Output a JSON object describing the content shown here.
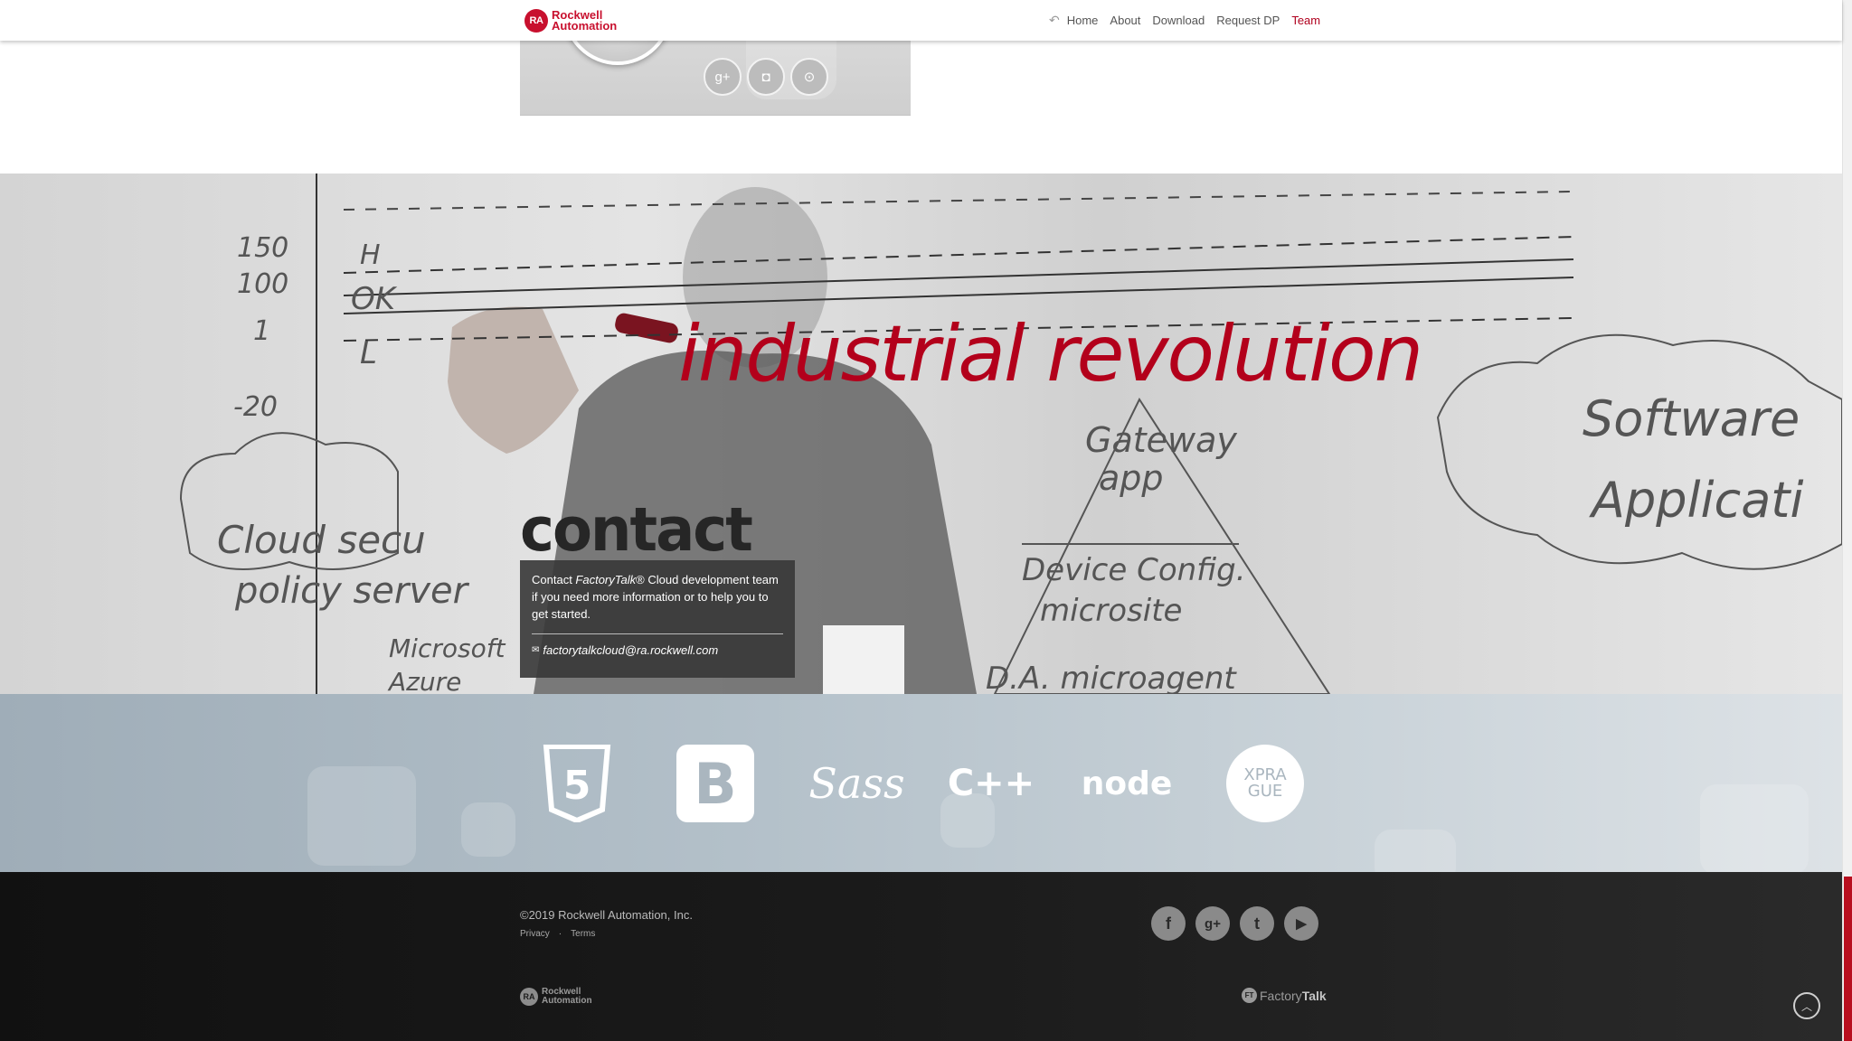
{
  "brand": {
    "badge": "RA",
    "line1": "Rockwell",
    "line2": "Automation"
  },
  "nav": {
    "back_icon": "reply-arrow-icon",
    "items": [
      {
        "label": "Home"
      },
      {
        "label": "About"
      },
      {
        "label": "Download"
      },
      {
        "label": "Request DP"
      },
      {
        "label": "Team",
        "active": true
      }
    ]
  },
  "team_card": {
    "social": [
      {
        "icon": "google-plus-icon",
        "glyph": "g+"
      },
      {
        "icon": "camera-icon",
        "glyph": "◘"
      },
      {
        "icon": "github-icon",
        "glyph": "⊙"
      }
    ]
  },
  "hero": {
    "headline": "industrial revolution",
    "whiteboard": {
      "axis_labels": [
        "150",
        "100",
        "1",
        "-20"
      ],
      "notes": [
        "H",
        "OK",
        "L",
        "Cloud secu",
        "policy server",
        "Microsoft",
        "Azure",
        "Gateway",
        "app",
        "Device Config.",
        "microsite",
        "D.A. microagent",
        "Software",
        "Applicati"
      ]
    }
  },
  "contact": {
    "heading": "contact",
    "text_before": "Contact ",
    "product": "FactoryTalk",
    "text_after": "® Cloud development team if you need more information or to help you to get started.",
    "email_icon": "envelope-icon",
    "email": "factorytalkcloud@ra.rockwell.com"
  },
  "tech_logos": [
    {
      "name": "html5-logo",
      "label": "5"
    },
    {
      "name": "bootstrap-logo",
      "label": "B"
    },
    {
      "name": "sass-logo",
      "label": "Sass"
    },
    {
      "name": "cpp-logo",
      "label": "C++"
    },
    {
      "name": "nodejs-logo",
      "label": "node"
    },
    {
      "name": "xpra-logo",
      "label": "XPRA GUE"
    }
  ],
  "footer": {
    "copyright": "©2019  Rockwell Automation, Inc.",
    "links": {
      "privacy": "Privacy",
      "terms": "Terms",
      "separator": "·"
    },
    "social": [
      {
        "icon": "facebook-icon",
        "glyph": "f"
      },
      {
        "icon": "google-plus-icon",
        "glyph": "g+"
      },
      {
        "icon": "twitter-icon",
        "glyph": "t"
      },
      {
        "icon": "youtube-icon",
        "glyph": "▶"
      }
    ],
    "ra_logo": {
      "badge": "RA",
      "line1": "Rockwell",
      "line2": "Automation"
    },
    "ft_logo": {
      "badge": "FT",
      "light": "Factory",
      "bold": "Talk"
    },
    "back_to_top_icon": "chevron-up-circle-icon"
  },
  "colors": {
    "accent": "#b0001e",
    "footer_bg": "#1b1b1b",
    "contact_box": "#373737"
  }
}
